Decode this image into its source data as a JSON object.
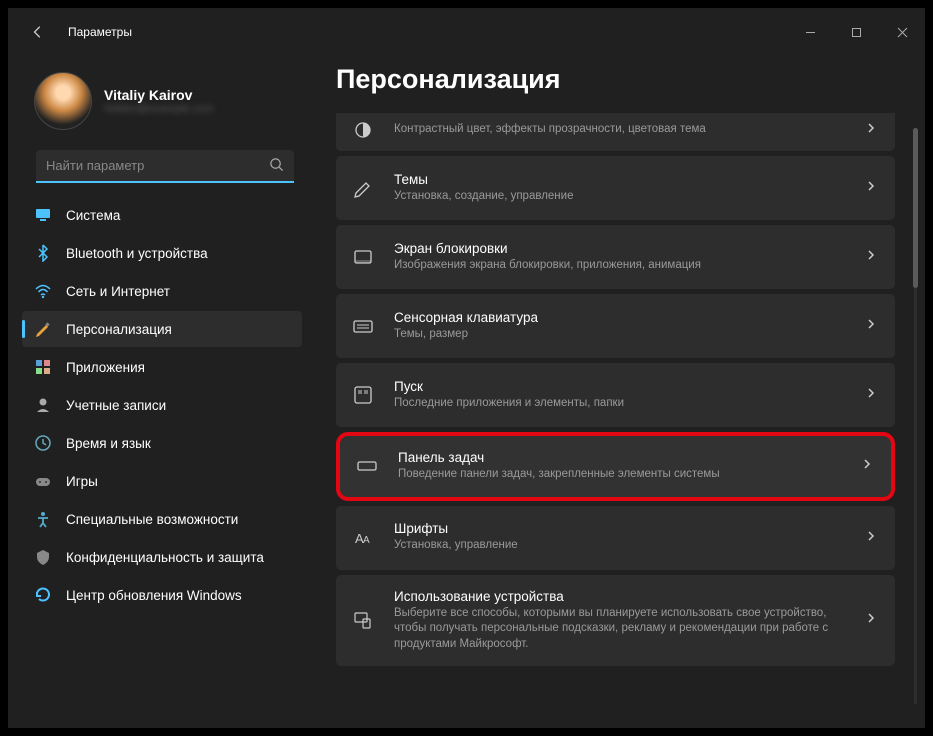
{
  "app": {
    "title": "Параметры"
  },
  "user": {
    "name": "Vitaliy Kairov",
    "email": "hidden@example.com"
  },
  "search": {
    "placeholder": "Найти параметр"
  },
  "nav": [
    {
      "icon": "system",
      "label": "Система"
    },
    {
      "icon": "bluetooth",
      "label": "Bluetooth и устройства"
    },
    {
      "icon": "wifi",
      "label": "Сеть и Интернет"
    },
    {
      "icon": "personalization",
      "label": "Персонализация"
    },
    {
      "icon": "apps",
      "label": "Приложения"
    },
    {
      "icon": "accounts",
      "label": "Учетные записи"
    },
    {
      "icon": "time",
      "label": "Время и язык"
    },
    {
      "icon": "gaming",
      "label": "Игры"
    },
    {
      "icon": "accessibility",
      "label": "Специальные возможности"
    },
    {
      "icon": "privacy",
      "label": "Конфиденциальность и защита"
    },
    {
      "icon": "update",
      "label": "Центр обновления Windows"
    }
  ],
  "activeNav": 3,
  "page": {
    "title": "Персонализация"
  },
  "items": [
    {
      "partial": true,
      "icon": "contrast",
      "title": "",
      "desc": "Контрастный цвет, эффекты прозрачности, цветовая тема"
    },
    {
      "icon": "themes",
      "title": "Темы",
      "desc": "Установка, создание, управление"
    },
    {
      "icon": "lockscreen",
      "title": "Экран блокировки",
      "desc": "Изображения экрана блокировки, приложения, анимация"
    },
    {
      "icon": "touchkb",
      "title": "Сенсорная клавиатура",
      "desc": "Темы, размер"
    },
    {
      "icon": "start",
      "title": "Пуск",
      "desc": "Последние приложения и элементы, папки"
    },
    {
      "highlight": true,
      "icon": "taskbar",
      "title": "Панель задач",
      "desc": "Поведение панели задач, закрепленные элементы системы"
    },
    {
      "icon": "fonts",
      "title": "Шрифты",
      "desc": "Установка, управление"
    },
    {
      "icon": "usage",
      "title": "Использование устройства",
      "desc": "Выберите все способы, которыми вы планируете использовать свое устройство, чтобы получать персональные подсказки, рекламу и рекомендации при работе с продуктами Майкрософт."
    }
  ]
}
